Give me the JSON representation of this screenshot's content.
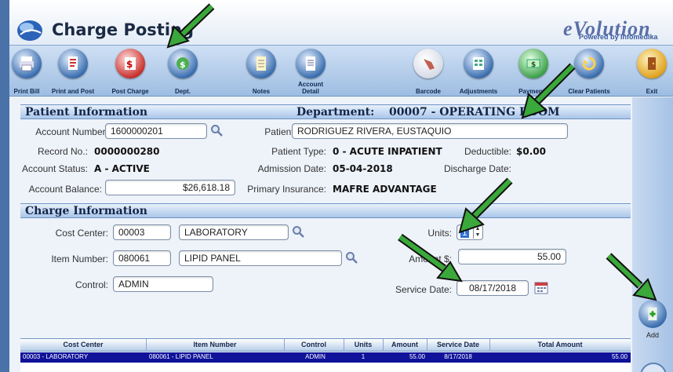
{
  "window": {
    "title": "Charge Posting"
  },
  "brand": {
    "logo_text": "eVolution",
    "tagline": "Powered by Infomedika"
  },
  "toolbar": [
    {
      "name": "print-bill-button",
      "icon": "printer-icon",
      "label": "Print Bill"
    },
    {
      "name": "print-and-post-button",
      "icon": "print-document-icon",
      "label": "Print and Post"
    },
    {
      "name": "post-charge-button",
      "icon": "money-document-icon",
      "label": "Post Charge"
    },
    {
      "name": "dept-button",
      "icon": "globe-money-icon",
      "label": "Dept."
    },
    {
      "name": "notes-button",
      "icon": "notepad-icon",
      "label": "Notes"
    },
    {
      "name": "account-detail-button",
      "icon": "document-icon",
      "label": "Account Detail"
    },
    {
      "name": "barcode-button",
      "icon": "barcode-scanner-icon",
      "label": "Barcode"
    },
    {
      "name": "adjustments-button",
      "icon": "spreadsheet-icon",
      "label": "Adjustments"
    },
    {
      "name": "payments-button",
      "icon": "cash-icon",
      "label": "Payments"
    },
    {
      "name": "clear-patients-button",
      "icon": "refresh-icon",
      "label": "Clear Patients"
    },
    {
      "name": "exit-button",
      "icon": "door-exit-icon",
      "label": "Exit"
    }
  ],
  "patient_info": {
    "section_title": "Patient Information",
    "department_label": "Department:",
    "department_value": "00007 - OPERATING ROOM",
    "account_number_label": "Account Number:",
    "account_number": "1600000201",
    "patient_label": "Patient:",
    "patient_name": "RODRIGUEZ RIVERA, EUSTAQUIO",
    "record_no_label": "Record No.:",
    "record_no": "0000000280",
    "patient_type_label": "Patient Type:",
    "patient_type": "0 - ACUTE INPATIENT",
    "deductible_label": "Deductible:",
    "deductible": "$0.00",
    "account_status_label": "Account Status:",
    "account_status": "A - ACTIVE",
    "admission_date_label": "Admission Date:",
    "admission_date": "05-04-2018",
    "discharge_date_label": "Discharge Date:",
    "account_balance_label": "Account Balance:",
    "account_balance": "$26,618.18",
    "primary_insurance_label": "Primary Insurance:",
    "primary_insurance": "MAFRE ADVANTAGE"
  },
  "charge_info": {
    "section_title": "Charge Information",
    "cost_center_label": "Cost Center:",
    "cost_center_code": "00003",
    "cost_center_name": "LABORATORY",
    "units_label": "Units:",
    "units": "1",
    "item_number_label": "Item Number:",
    "item_number": "080061",
    "item_name": "LIPID PANEL",
    "amount_label": "Amount $:",
    "amount": "55.00",
    "control_label": "Control:",
    "control": "ADMIN",
    "service_date_label": "Service Date:",
    "service_date": "08/17/2018"
  },
  "grid": {
    "columns": [
      "Cost Center",
      "Item Number",
      "Control",
      "Units",
      "Amount",
      "Service Date",
      "Total Amount"
    ],
    "rows": [
      {
        "cost_center": "00003 - LABORATORY",
        "item_number": "080061 - LIPID PANEL",
        "control": "ADMIN",
        "units": "1",
        "amount": "55.00",
        "service_date": "8/17/2018",
        "total_amount": "55.00"
      }
    ]
  },
  "sidebar": {
    "add_label": "Add"
  },
  "colors": {
    "frame_blue": "#4a72a8",
    "selected_row": "#10139a",
    "arrow_green": "#3aa83a"
  }
}
